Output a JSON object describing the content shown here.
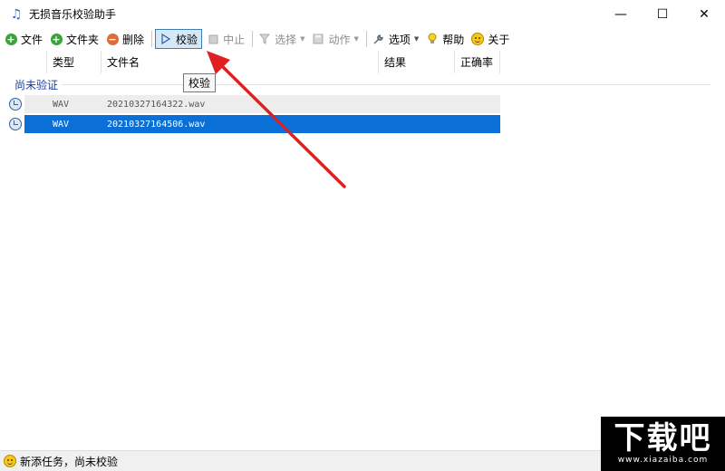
{
  "window": {
    "title": "无损音乐校验助手",
    "icon": "music-note-icon",
    "controls": {
      "minimize": "—",
      "maximize": "☐",
      "close": "✕"
    }
  },
  "toolbar": {
    "file_label": "文件",
    "folder_label": "文件夹",
    "delete_label": "删除",
    "verify_label": "校验",
    "stop_label": "中止",
    "select_label": "选择",
    "action_label": "动作",
    "options_label": "选项",
    "help_label": "帮助",
    "about_label": "关于"
  },
  "list": {
    "columns": [
      "类型",
      "文件名",
      "结果",
      "正确率"
    ],
    "group_label": "尚未验证",
    "rows": [
      {
        "type": "WAV",
        "filename": "20210327164322.wav",
        "result": "",
        "accuracy": "",
        "selected": false
      },
      {
        "type": "WAV",
        "filename": "20210327164506.wav",
        "result": "",
        "accuracy": "",
        "selected": true
      }
    ]
  },
  "tooltip": {
    "text": "校验"
  },
  "status": {
    "text": "新添任务，尚未校验"
  },
  "watermark": {
    "main": "下载吧",
    "sub": "www.xiazaiba.com"
  },
  "colors": {
    "selection": "#0a6fd6",
    "group_label": "#1e3f9e",
    "annotation_arrow": "#e02020",
    "active_button_bg": "#d5e8f7",
    "active_button_border": "#3c7fb1"
  }
}
